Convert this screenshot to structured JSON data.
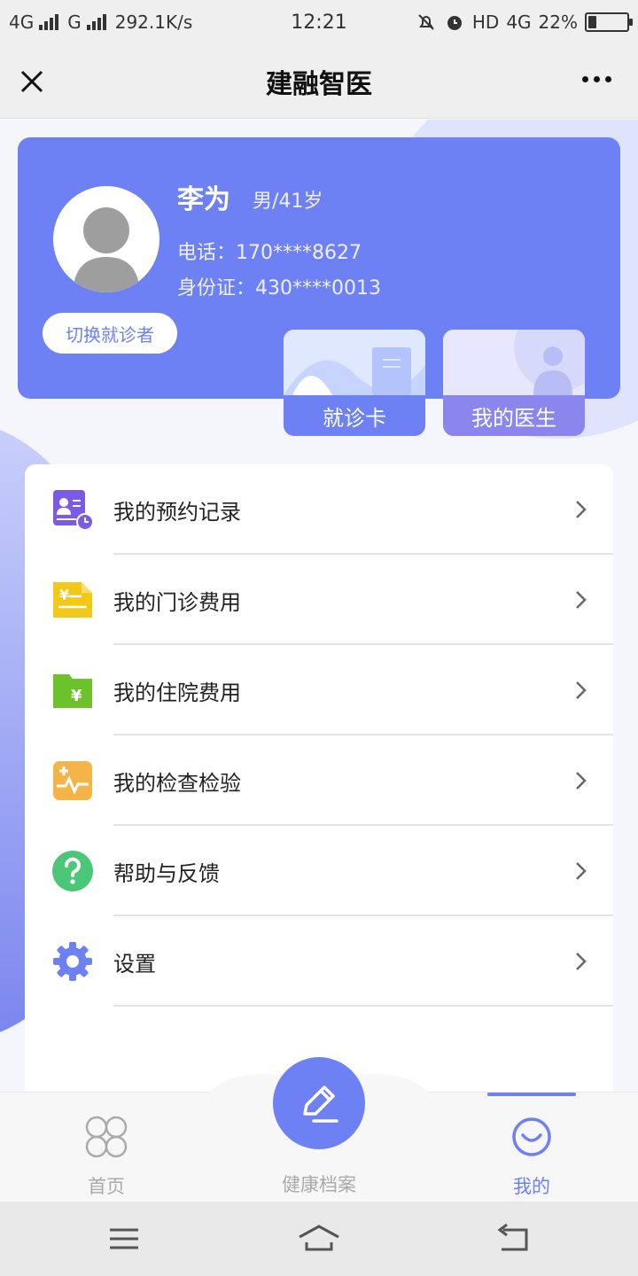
{
  "status_bar": {
    "network1": "4G",
    "network2": "G",
    "speed": "292.1K/s",
    "time": "12:21",
    "hd_label": "HD",
    "net_right": "4G",
    "battery": "22%",
    "battery_level": 0.22
  },
  "titlebar": {
    "title": "建融智医"
  },
  "profile": {
    "name": "李为",
    "gender_age": "男/41岁",
    "phone": "电话：170****8627",
    "id_card": "身份证：430****0013",
    "switch_label": "切换就诊者"
  },
  "quick_cards": [
    {
      "label": "就诊卡"
    },
    {
      "label": "我的医生"
    }
  ],
  "menu": [
    {
      "label": "我的预约记录",
      "icon": "appointment-icon"
    },
    {
      "label": "我的门诊费用",
      "icon": "outpatient-fee-icon"
    },
    {
      "label": "我的住院费用",
      "icon": "hospitalization-fee-icon"
    },
    {
      "label": "我的检查检验",
      "icon": "exam-icon"
    },
    {
      "label": "帮助与反馈",
      "icon": "help-icon"
    },
    {
      "label": "设置",
      "icon": "settings-icon"
    }
  ],
  "tabbar": {
    "home": "首页",
    "records": "健康档案",
    "mine": "我的",
    "active": "mine"
  },
  "colors": {
    "accent": "#6d81f5",
    "doctor_card": "#8a86ee"
  }
}
